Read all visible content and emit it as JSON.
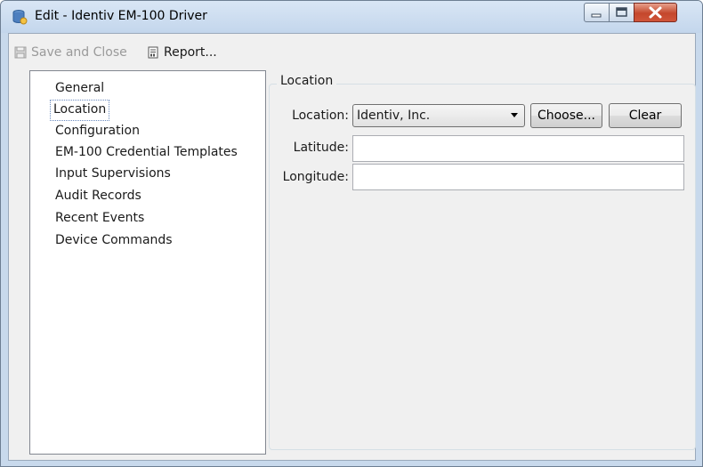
{
  "window": {
    "title": "Edit - Identiv EM-100 Driver",
    "icons": {
      "app": "database-icon",
      "minimize": "minimize-icon",
      "maximize": "maximize-icon",
      "close": "close-icon"
    }
  },
  "toolbar": {
    "save_close_label": "Save and Close",
    "save_close_icon": "floppy-disk-icon",
    "report_label": "Report...",
    "report_icon": "report-icon"
  },
  "tree": {
    "items": [
      {
        "label": "General"
      },
      {
        "label": "Location",
        "selected": true
      },
      {
        "label": "Configuration"
      },
      {
        "label": "EM-100 Credential Templates"
      },
      {
        "label": "Input Supervisions"
      },
      {
        "label": "Audit Records"
      },
      {
        "label": "Recent Events"
      },
      {
        "label": "Device Commands"
      }
    ]
  },
  "location_group": {
    "legend": "Location",
    "location_label": "Location:",
    "location_value": "Identiv, Inc.",
    "choose_label": "Choose...",
    "clear_label": "Clear",
    "latitude_label": "Latitude:",
    "latitude_value": "",
    "longitude_label": "Longitude:",
    "longitude_value": ""
  },
  "colors": {
    "frame": "#c8d9ec",
    "client": "#f0f0f0",
    "close_button": "#c4472c",
    "selection_border": "#6a8bbf"
  }
}
